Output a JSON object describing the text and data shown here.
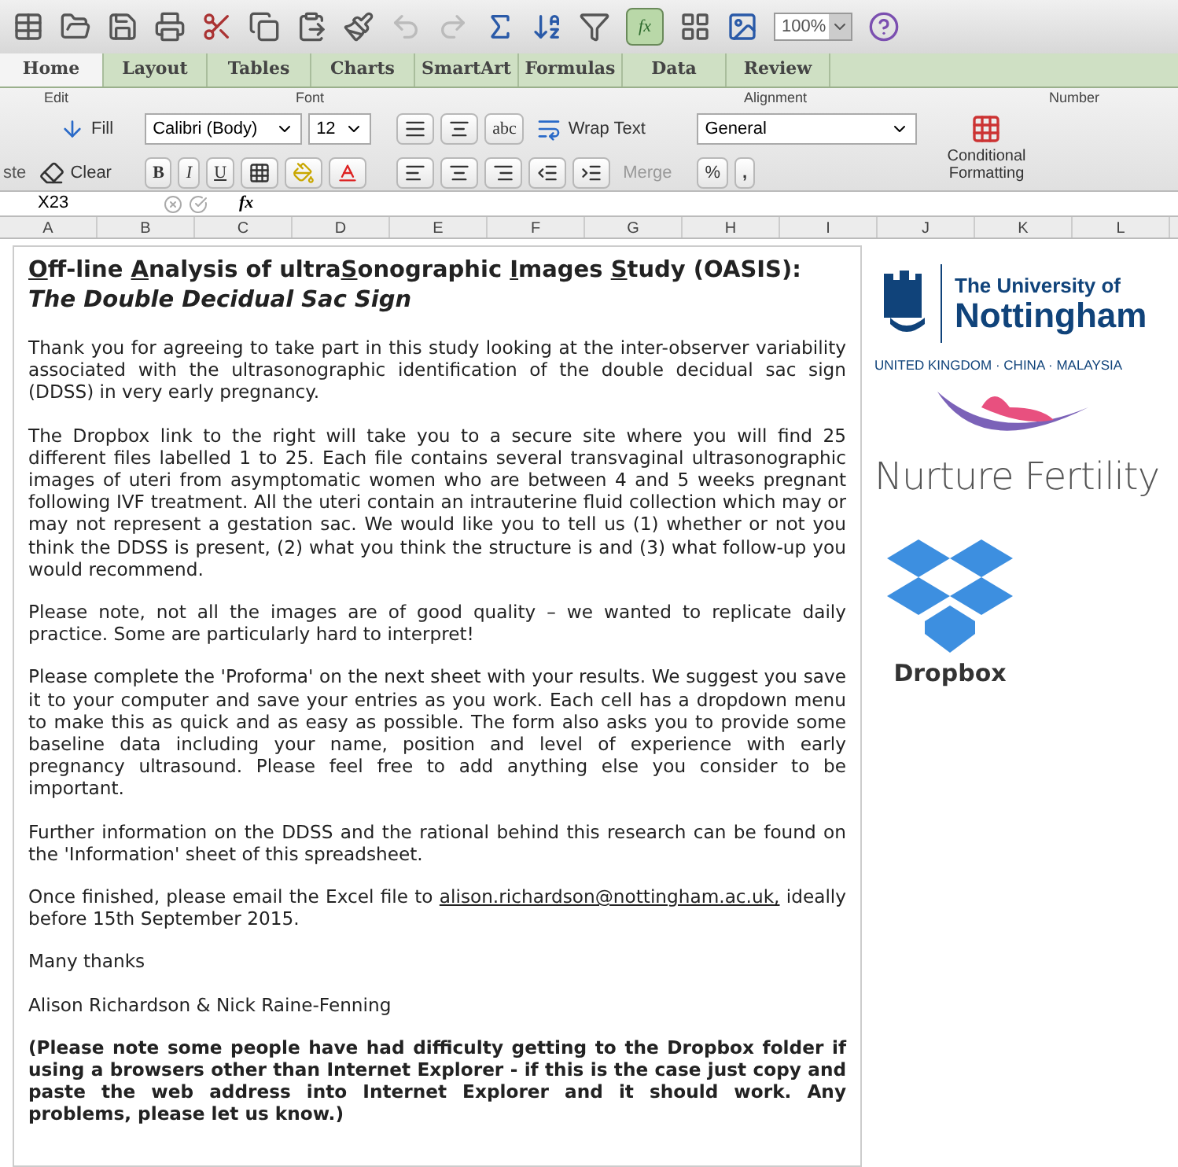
{
  "toolbar": {
    "formula_builder": "fx",
    "zoom": "100%"
  },
  "tabs": [
    {
      "label": "Home",
      "selected": true
    },
    {
      "label": "Layout",
      "selected": false
    },
    {
      "label": "Tables",
      "selected": false
    },
    {
      "label": "Charts",
      "selected": false
    },
    {
      "label": "SmartArt",
      "selected": false
    },
    {
      "label": "Formulas",
      "selected": false
    },
    {
      "label": "Data",
      "selected": false
    },
    {
      "label": "Review",
      "selected": false
    }
  ],
  "ribbon": {
    "groups": [
      "Edit",
      "Font",
      "Alignment",
      "Number"
    ],
    "paste": "ste",
    "fill": "Fill",
    "clear": "Clear",
    "font": "Calibri (Body)",
    "size": "12",
    "bold": "B",
    "italic": "I",
    "underline": "U",
    "orientation": "abc",
    "wrap": "Wrap Text",
    "merge": "Merge",
    "number_format": "General",
    "percent": "%",
    "comma": ",",
    "conditional": "Conditional Formatting"
  },
  "formula_bar": {
    "name_box": "X23",
    "fx": "fx"
  },
  "columns": [
    "A",
    "B",
    "C",
    "D",
    "E",
    "F",
    "G",
    "H",
    "I",
    "J",
    "K",
    "L"
  ],
  "document": {
    "title": [
      {
        "text": "O",
        "underline": true,
        "italic": false
      },
      {
        "text": "ff-line ",
        "underline": false,
        "italic": false
      },
      {
        "text": "A",
        "underline": true,
        "italic": false
      },
      {
        "text": "nalysis of ultra",
        "underline": false,
        "italic": false
      },
      {
        "text": "S",
        "underline": true,
        "italic": false
      },
      {
        "text": "onographic ",
        "underline": false,
        "italic": false
      },
      {
        "text": "I",
        "underline": true,
        "italic": false
      },
      {
        "text": "mages ",
        "underline": false,
        "italic": false
      },
      {
        "text": "S",
        "underline": true,
        "italic": false
      },
      {
        "text": "tudy (OASIS): ",
        "underline": false,
        "italic": false
      },
      {
        "text": "The Double Decidual Sac Sign",
        "underline": false,
        "italic": true
      }
    ],
    "paragraphs": [
      {
        "kind": "text",
        "text": "Thank you for agreeing to take part in this study looking at the inter-observer variability associated with the ultrasonographic identification of the double decidual sac sign (DDSS) in very early pregnancy."
      },
      {
        "kind": "text",
        "text": "The Dropbox link to the right will take you to a secure site where you will find 25 different files labelled 1 to 25.  Each file contains several transvaginal ultrasonographic images of uteri from asymptomatic women who are between 4 and 5 weeks pregnant following IVF treatment.  All the uteri contain an intrauterine fluid collection which may or may not represent a gestation sac.  We would like you to tell us (1) whether or not you think the DDSS is present, (2) what you think the structure is and (3) what follow-up you would recommend."
      },
      {
        "kind": "text",
        "text": "Please note, not all the images are of good quality – we wanted to replicate daily practice.  Some are particularly hard to interpret!"
      },
      {
        "kind": "text",
        "text": "Please complete the 'Proforma' on the next sheet with your results.  We suggest you save it to your computer and save your entries as you work.  Each cell has a dropdown menu to make this as quick and as easy as possible.  The form also asks you to provide some baseline data including your name, position and level of experience with early pregnancy ultrasound.  Please feel free to add anything else you consider to be important."
      },
      {
        "kind": "text",
        "text": "Further information on the DDSS and the rational behind this research can be found on the 'Information' sheet of this spreadsheet."
      },
      {
        "kind": "email",
        "before": "Once finished, please email the Excel file to ",
        "link": "alison.richardson@nottingham.ac.uk,",
        "after": " ideally before 15th September 2015."
      },
      {
        "kind": "text",
        "text": "Many thanks"
      },
      {
        "kind": "text",
        "text": "Alison Richardson & Nick Raine-Fenning"
      },
      {
        "kind": "bold",
        "text": "(Please note some people have had difficulty getting to the Dropbox folder if using a browsers other than Internet Explorer - if this is the case just copy and paste the web address into Internet Explorer and it should work.  Any problems, please let us know.)"
      }
    ]
  },
  "logos": {
    "university_line1": "The University of",
    "university_line2": "Nottingham",
    "university_tagline": "UNITED KINGDOM · CHINA · MALAYSIA",
    "nurture": "Nurture Fertility",
    "dropbox": "Dropbox"
  }
}
